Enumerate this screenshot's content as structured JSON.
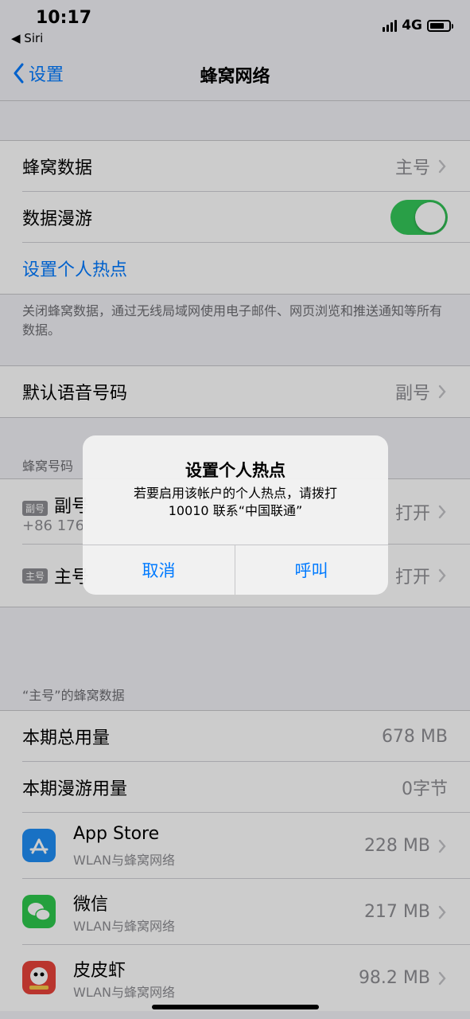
{
  "status": {
    "time": "10:17",
    "back_app": "◀ Siri",
    "network": "4G"
  },
  "nav": {
    "back_label": "设置",
    "title": "蜂窝网络"
  },
  "main": {
    "cellular_data": {
      "label": "蜂窝数据",
      "value": "主号"
    },
    "data_roaming": {
      "label": "数据漫游",
      "enabled": true
    },
    "hotspot_link": "设置个人热点",
    "footer": "关闭蜂窝数据，通过无线局域网使用电子邮件、网页浏览和推送通知等所有数据。",
    "default_voice": {
      "label": "默认语音号码",
      "value": "副号"
    },
    "plans_header": "蜂窝号码",
    "plans": [
      {
        "badge": "副号",
        "name": "副号",
        "number": "+86 176",
        "status": "打开"
      },
      {
        "badge": "主号",
        "name": "主号",
        "status": "打开"
      }
    ],
    "usage_header": "“主号”的蜂窝数据",
    "current_period": {
      "label": "本期总用量",
      "value": "678 MB"
    },
    "roaming_period": {
      "label": "本期漫游用量",
      "value": "0字节"
    },
    "apps": [
      {
        "name": "App Store",
        "sub": "WLAN与蜂窝网络",
        "value": "228 MB",
        "icon": "app-store-icon",
        "color": "#1e8ef5"
      },
      {
        "name": "微信",
        "sub": "WLAN与蜂窝网络",
        "value": "217 MB",
        "icon": "wechat-icon",
        "color": "#2dc84d"
      },
      {
        "name": "皮皮虾",
        "sub": "WLAN与蜂窝网络",
        "value": "98.2 MB",
        "icon": "pipixia-icon",
        "color": "#e8433a"
      }
    ]
  },
  "alert": {
    "title": "设置个人热点",
    "message_line1": "若要启用该帐户的个人热点，请拨打",
    "message_line2": "10010 联系“中国联通”",
    "cancel": "取消",
    "call": "呼叫"
  }
}
